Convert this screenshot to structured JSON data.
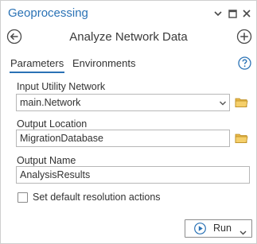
{
  "pane": {
    "title": "Geoprocessing",
    "accent_color": "#2a72b5",
    "icons": {
      "menu": "chevron-down-icon",
      "maximize": "maximize-icon",
      "close": "close-icon",
      "back": "back-arrow-icon",
      "add": "add-icon",
      "help": "help-icon",
      "folder": "folder-icon",
      "run": "play-icon"
    }
  },
  "tool": {
    "title": "Analyze Network Data"
  },
  "tabs": [
    {
      "label": "Parameters",
      "active": true
    },
    {
      "label": "Environments",
      "active": false
    }
  ],
  "params": {
    "input_network": {
      "label": "Input Utility Network",
      "value": "main.Network"
    },
    "output_location": {
      "label": "Output Location",
      "value": "MigrationDatabase"
    },
    "output_name": {
      "label": "Output Name",
      "value": "AnalysisResults"
    },
    "default_resolution": {
      "label": "Set default resolution actions",
      "checked": false
    }
  },
  "run_button": {
    "label": "Run"
  }
}
